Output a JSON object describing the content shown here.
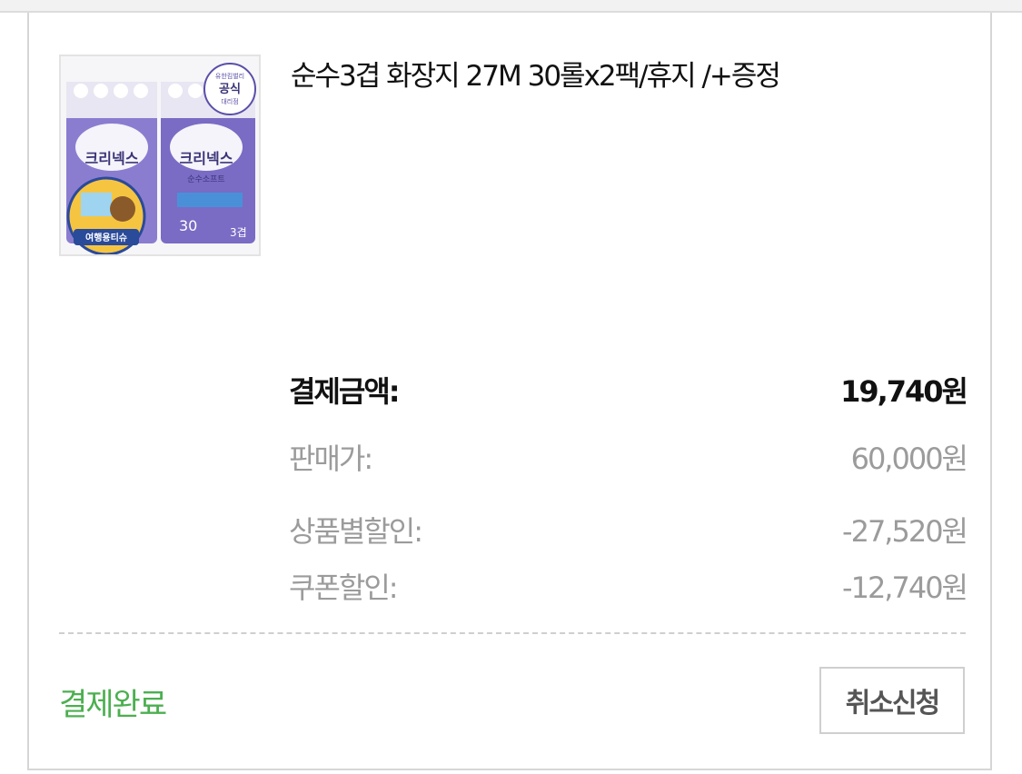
{
  "order": {
    "product": {
      "title": "순수3겹 화장지 27M 30롤x2팩/휴지 /+증정",
      "image_labels": {
        "brand": "크리넥스",
        "badge_line1": "유한킴벌리",
        "badge_line2": "공식",
        "badge_line3": "대리점",
        "sub_brand": "순수소프트",
        "roll_count": "30",
        "ply": "3겹",
        "gift_label": "여행용티슈"
      }
    },
    "price": {
      "total_label": "결제금액:",
      "total_value": "19,740원",
      "sale_label": "판매가:",
      "sale_value": "60,000원",
      "product_discount_label": "상품별할인:",
      "product_discount_value": "-27,520원",
      "coupon_discount_label": "쿠폰할인:",
      "coupon_discount_value": "-12,740원"
    },
    "status": "결제완료",
    "cancel_button_label": "취소신청"
  },
  "colors": {
    "status_green": "#4caf50",
    "package_purple": "#7a6bc4",
    "border_gray": "#d6d6d6"
  }
}
